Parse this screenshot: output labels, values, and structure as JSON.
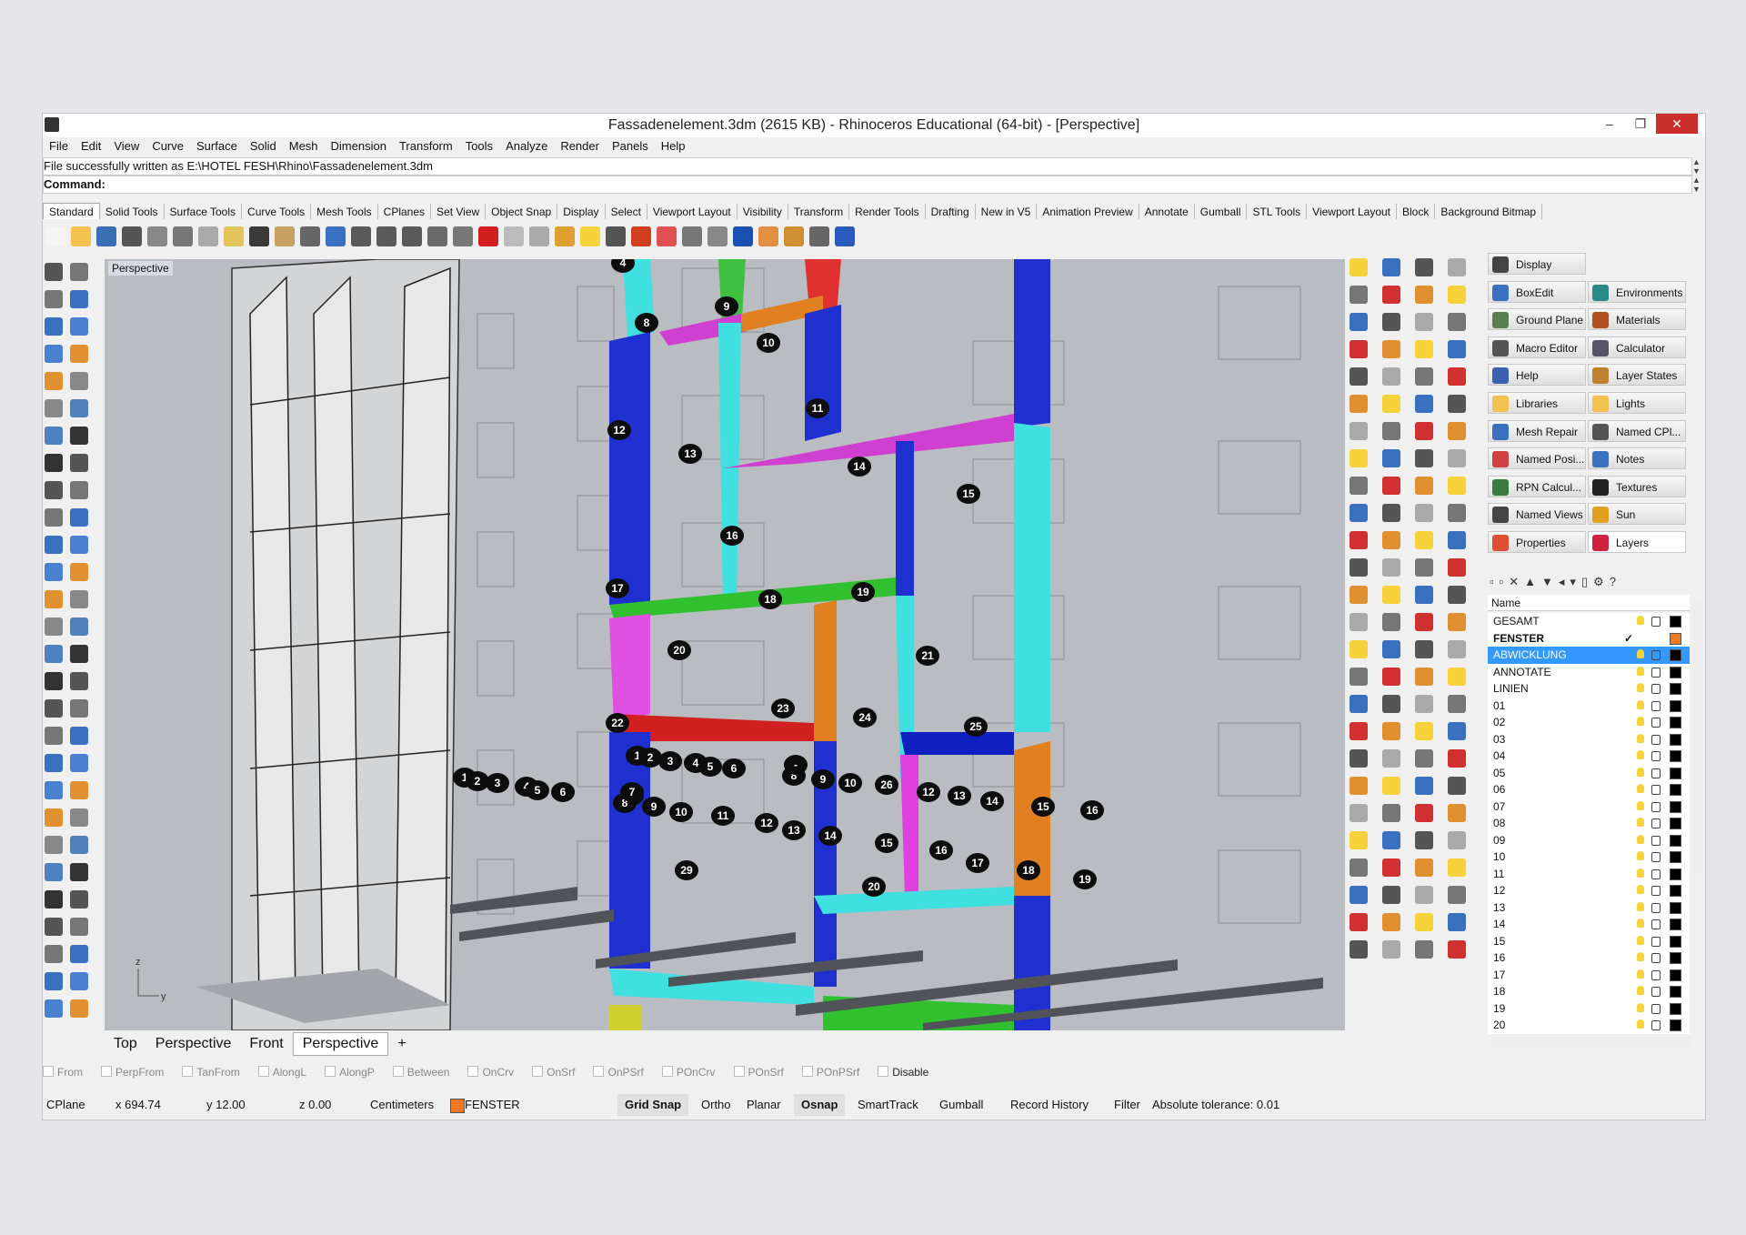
{
  "window": {
    "title": "Fassadenelement.3dm (2615 KB) - Rhinoceros Educational (64-bit) - [Perspective]",
    "minimize": "–",
    "restore": "❐",
    "close": "✕"
  },
  "menu": [
    "File",
    "Edit",
    "View",
    "Curve",
    "Surface",
    "Solid",
    "Mesh",
    "Dimension",
    "Transform",
    "Tools",
    "Analyze",
    "Render",
    "Panels",
    "Help"
  ],
  "command_history": "File successfully written as E:\\HOTEL FESH\\Rhino\\Fassadenelement.3dm",
  "command_prompt": "Command:",
  "toolbar_tabs": [
    "Standard",
    "Solid Tools",
    "Surface Tools",
    "Curve Tools",
    "Mesh Tools",
    "CPlanes",
    "Set View",
    "Object Snap",
    "Display",
    "Select",
    "Viewport Layout",
    "Visibility",
    "Transform",
    "Render Tools",
    "Drafting",
    "New in V5",
    "Animation Preview",
    "Annotate",
    "Gumball",
    "STL Tools",
    "Viewport Layout",
    "Block",
    "Background Bitmap"
  ],
  "viewport": {
    "label": "Perspective",
    "labels": [
      "4",
      "8",
      "9",
      "10",
      "11",
      "12",
      "13",
      "14",
      "15",
      "16",
      "17",
      "18",
      "19",
      "20",
      "21",
      "22",
      "23",
      "24",
      "25",
      "1",
      "2",
      "3",
      "4",
      "5",
      "6",
      "1",
      "2",
      "3",
      "4",
      "5",
      "6",
      "7",
      "8",
      "9",
      "10",
      "11",
      "12",
      "13",
      "14",
      "15",
      "16",
      "17",
      "18",
      "19",
      "8",
      "9",
      "10",
      "26",
      "12",
      "13",
      "14",
      "15",
      "16",
      "29",
      "20",
      "-",
      "7"
    ]
  },
  "viewport_tabs": [
    "Top",
    "Perspective",
    "Front",
    "Perspective"
  ],
  "viewport_tab_add": "+",
  "osnaps": [
    "From",
    "PerpFrom",
    "TanFrom",
    "AlongL",
    "AlongP",
    "Between",
    "OnCrv",
    "OnSrf",
    "OnPSrf",
    "POnCrv",
    "POnSrf",
    "POnPSrf",
    "Disable"
  ],
  "status": {
    "cplane": "CPlane",
    "x": "x 694.74",
    "y": "y 12.00",
    "z": "z 0.00",
    "units": "Centimeters",
    "layer": "FENSTER",
    "grid_snap": "Grid Snap",
    "ortho": "Ortho",
    "planar": "Planar",
    "osnap": "Osnap",
    "smarttrack": "SmartTrack",
    "gumball": "Gumball",
    "record_history": "Record History",
    "filter": "Filter",
    "tolerance": "Absolute tolerance: 0.01"
  },
  "panels_left": [
    "Display",
    "BoxEdit",
    "Ground Plane",
    "Macro Editor",
    "Help",
    "Libraries",
    "Mesh Repair",
    "Named Posi...",
    "RPN Calcul...",
    "Named Views",
    "Properties"
  ],
  "panels_right": [
    "Environments",
    "Materials",
    "Calculator",
    "Layer States",
    "Lights",
    "Named CPl...",
    "Notes",
    "Textures",
    "Sun",
    "Layers"
  ],
  "layers_header": "Name",
  "layers": [
    {
      "name": "GESAMT",
      "color": "#000000"
    },
    {
      "name": "FENSTER",
      "color": "#f07820"
    },
    {
      "name": "ABWICKLUNG",
      "color": "#000000"
    },
    {
      "name": "ANNOTATE",
      "color": "#000000"
    },
    {
      "name": "LINIEN",
      "color": "#000000"
    },
    {
      "name": "01",
      "color": "#000000"
    },
    {
      "name": "02",
      "color": "#000000"
    },
    {
      "name": "03",
      "color": "#000000"
    },
    {
      "name": "04",
      "color": "#000000"
    },
    {
      "name": "05",
      "color": "#000000"
    },
    {
      "name": "06",
      "color": "#000000"
    },
    {
      "name": "07",
      "color": "#000000"
    },
    {
      "name": "08",
      "color": "#000000"
    },
    {
      "name": "09",
      "color": "#000000"
    },
    {
      "name": "10",
      "color": "#000000"
    },
    {
      "name": "11",
      "color": "#000000"
    },
    {
      "name": "12",
      "color": "#000000"
    },
    {
      "name": "13",
      "color": "#000000"
    },
    {
      "name": "14",
      "color": "#000000"
    },
    {
      "name": "15",
      "color": "#000000"
    },
    {
      "name": "16",
      "color": "#000000"
    },
    {
      "name": "17",
      "color": "#000000"
    },
    {
      "name": "18",
      "color": "#000000"
    },
    {
      "name": "19",
      "color": "#000000"
    },
    {
      "name": "20",
      "color": "#000000"
    }
  ],
  "current_layer_mark": "✓",
  "layer_toolbar": "▫▫✕▲▼◂▾▯⚙?"
}
